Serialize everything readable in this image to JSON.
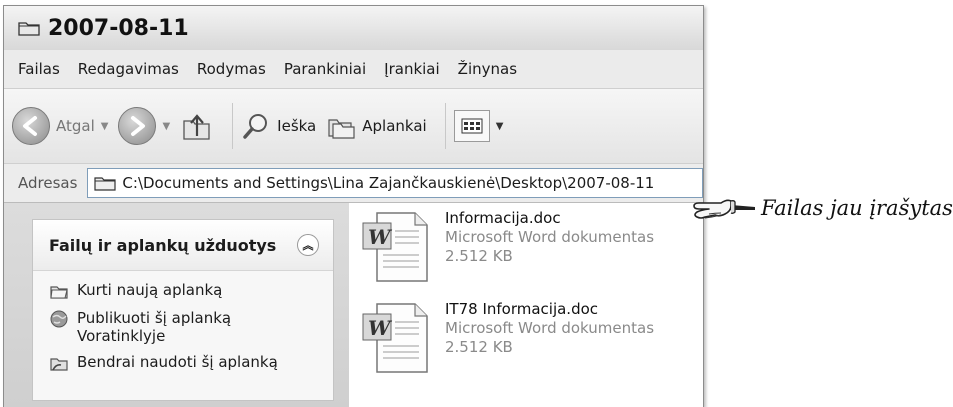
{
  "window": {
    "title": "2007-08-11"
  },
  "menu": [
    "Failas",
    "Redagavimas",
    "Rodymas",
    "Parankiniai",
    "Įrankiai",
    "Žinynas"
  ],
  "toolbar": {
    "back_label": "Atgal",
    "search_label": "Ieška",
    "folders_label": "Aplankai"
  },
  "address": {
    "label": "Adresas",
    "value": "C:\\Documents and Settings\\Lina Zajančkauskienė\\Desktop\\2007-08-11"
  },
  "tasks": {
    "title": "Failų ir aplankų užduotys",
    "items": [
      {
        "label": "Kurti naują aplanką",
        "icon": "new-folder-icon"
      },
      {
        "label": "Publikuoti šį aplanką Voratinklyje",
        "icon": "publish-globe-icon"
      },
      {
        "label": "Bendrai naudoti šį aplanką",
        "icon": "share-folder-icon"
      }
    ]
  },
  "files": [
    {
      "name": "Informacija.doc",
      "type": "Microsoft Word dokumentas",
      "size": "2.512 KB"
    },
    {
      "name": "IT78 Informacija.doc",
      "type": "Microsoft Word dokumentas",
      "size": "2.512 KB"
    }
  ],
  "callout": {
    "text": "Failas jau įrašytas"
  }
}
